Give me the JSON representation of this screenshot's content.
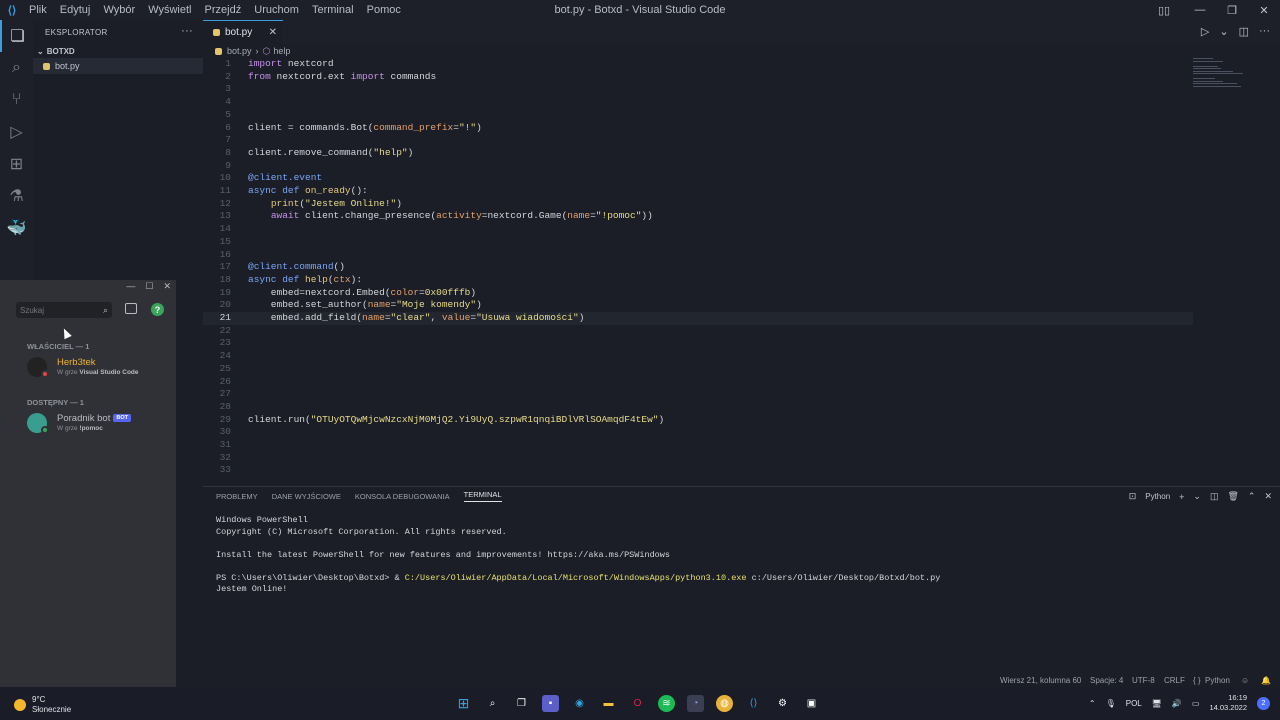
{
  "titlebar": {
    "menu": [
      "Plik",
      "Edytuj",
      "Wybór",
      "Wyświetl",
      "Przejdź",
      "Uruchom",
      "Terminal",
      "Pomoc"
    ],
    "title": "bot.py - Botxd - Visual Studio Code"
  },
  "sidebar": {
    "header": "EKSPLORATOR",
    "folder": "BOTXD",
    "file": "bot.py"
  },
  "tab": {
    "label": "bot.py"
  },
  "breadcrumb": {
    "file": "bot.py",
    "symbol": "help"
  },
  "editor": {
    "current_line": 21,
    "lines": [
      {
        "n": "1"
      },
      {
        "n": "2"
      },
      {
        "n": "3"
      },
      {
        "n": "4"
      },
      {
        "n": "5"
      },
      {
        "n": "6"
      },
      {
        "n": "7"
      },
      {
        "n": "8"
      },
      {
        "n": "9"
      },
      {
        "n": "10"
      },
      {
        "n": "11"
      },
      {
        "n": "12"
      },
      {
        "n": "13"
      },
      {
        "n": "14"
      },
      {
        "n": "15"
      },
      {
        "n": "16"
      },
      {
        "n": "17"
      },
      {
        "n": "18"
      },
      {
        "n": "19"
      },
      {
        "n": "20"
      },
      {
        "n": "21"
      },
      {
        "n": "22"
      },
      {
        "n": "23"
      },
      {
        "n": "24"
      },
      {
        "n": "25"
      },
      {
        "n": "26"
      },
      {
        "n": "27"
      },
      {
        "n": "28"
      },
      {
        "n": "29"
      },
      {
        "n": "30"
      },
      {
        "n": "31"
      },
      {
        "n": "32"
      },
      {
        "n": "33"
      }
    ]
  },
  "panel": {
    "tabs": [
      "PROBLEMY",
      "DANE WYJŚCIOWE",
      "KONSOLA DEBUGOWANIA",
      "TERMINAL"
    ],
    "active_tab": "TERMINAL",
    "shell": "Python",
    "terminal": {
      "l1": "Windows PowerShell",
      "l2": "Copyright (C) Microsoft Corporation. All rights reserved.",
      "l3": "Install the latest PowerShell for new features and improvements! https://aka.ms/PSWindows",
      "prompt": "PS C:\\Users\\Oliwier\\Desktop\\Botxd> & ",
      "exe": "C:/Users/Oliwier/AppData/Local/Microsoft/WindowsApps/python3.10.exe",
      "arg": " c:/Users/Oliwier/Desktop/Botxd/bot.py",
      "out": "Jestem Online!"
    }
  },
  "status": {
    "position": "Wiersz 21, kolumna 60",
    "spaces": "Spacje: 4",
    "encoding": "UTF-8",
    "eol": "CRLF",
    "language": "Python"
  },
  "discord": {
    "search_placeholder": "Szukaj",
    "section_owner": "WŁAŚCICIEL — 1",
    "section_online": "DOSTĘPNY — 1",
    "member1": {
      "name": "Herb3tek",
      "activity_prefix": "W grze",
      "activity": "Visual Studio Code"
    },
    "member2": {
      "name": "Poradnik bot",
      "badge": "BOT",
      "activity_prefix": "W grze",
      "activity": "!pomoc"
    }
  },
  "taskbar": {
    "temp": "9°C",
    "weather": "Słonecznie",
    "lang": "POL",
    "time": "16:19",
    "date": "14.03.2022",
    "notifications": "2"
  },
  "colors": {
    "accent": "#3c9de0",
    "discord_bg": "#2f3136",
    "editor_bg": "#1b1e27"
  }
}
